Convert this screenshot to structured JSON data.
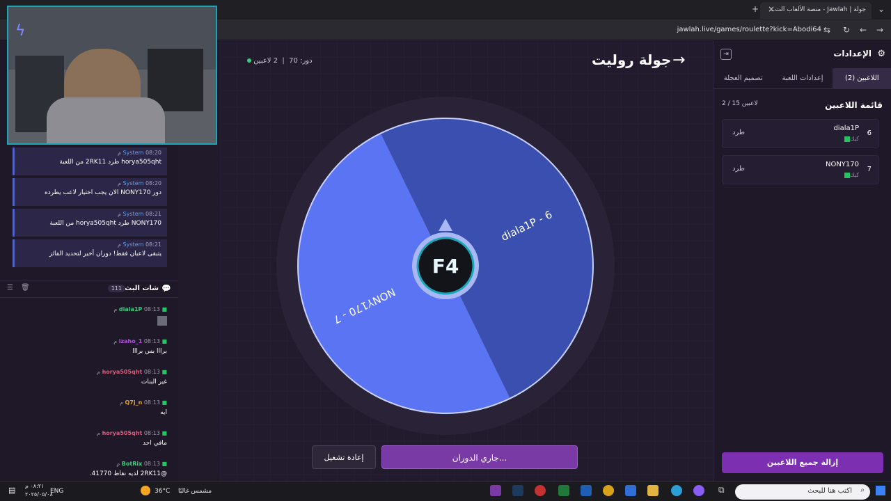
{
  "browser": {
    "tab_title": "جولة | Jawlah - منصة الألعاب الت...",
    "url": "jawlah.live/games/roulette?kick=Abodi64",
    "new_tab": "+",
    "close": "×"
  },
  "stage": {
    "title": "جولة روليت",
    "players_status": "2 لاعبين",
    "turn_label": "دور: 70"
  },
  "wheel": {
    "segments": [
      {
        "label": "diala1P - 6",
        "color": "#3a4fb0",
        "start_deg": 334,
        "end_deg": 154
      },
      {
        "label": "NONY170 - 7",
        "color": "#5b74f3",
        "start_deg": 154,
        "end_deg": 334
      }
    ],
    "logo": "F4"
  },
  "buttons": {
    "spinning": "جاري الدوران...",
    "replay": "إعادة تشغيل"
  },
  "settings": {
    "title": "الإعدادات",
    "tabs": [
      "اللاعبين (2)",
      "إعدادات اللعبة",
      "تصميم العجلة"
    ],
    "list_title": "قائمة اللاعبين",
    "list_count": "2 / 15 لاعبين",
    "players": [
      {
        "num": "6",
        "name": "diala1P",
        "source": "كيك",
        "action": "طرد"
      },
      {
        "num": "7",
        "name": "NONY170",
        "source": "كيك",
        "action": "طرد"
      }
    ],
    "clear_all": "إزالة جميع اللاعبين"
  },
  "system_messages": [
    {
      "sender": "System",
      "time": "08:20 م",
      "text": "horya505qht طرد 2RK11 من اللعبة"
    },
    {
      "sender": "System",
      "time": "08:20 م",
      "text": "دور NONY170 الان يجب اختيار لاعب يطرده"
    },
    {
      "sender": "System",
      "time": "08:21 م",
      "text": "NONY170 طرد horya505qht من اللعبة"
    },
    {
      "sender": "System",
      "time": "08:21 م",
      "text": "يتبقى لاعبان فقط! دوران أخير لتحديد الفائز"
    }
  ],
  "chat": {
    "title": "شات البث",
    "count": "111",
    "messages": [
      {
        "user": "diala1P",
        "time": "08:13 م",
        "text": "",
        "user_color": "#33d17a"
      },
      {
        "user": "izaho_1",
        "time": "08:13 م",
        "text": "برااا بس برااا",
        "user_color": "#b34fe0"
      },
      {
        "user": "horya505qht",
        "time": "08:13 م",
        "text": "غير البنات",
        "user_color": "#e05a7a"
      },
      {
        "user": "Q7j_n",
        "time": "08:13 م",
        "text": "ايه",
        "user_color": "#e0a43a"
      },
      {
        "user": "horya505qht",
        "time": "08:13 م",
        "text": "مافي احد",
        "user_color": "#e05a7a"
      },
      {
        "user": "BotRix",
        "time": "08:13 م",
        "text": "@2RK11 لديه نقاط 41770.",
        "user_color": "#33d17a"
      }
    ]
  },
  "taskbar": {
    "search_placeholder": "اكتب هنا للبحث",
    "weather": "36°C",
    "weather_text": "مشمس غالبًا",
    "lang": "ENG",
    "time": "٠٨:٢١ م",
    "date": "٢٠٢٥/٠٥/٠٨"
  }
}
